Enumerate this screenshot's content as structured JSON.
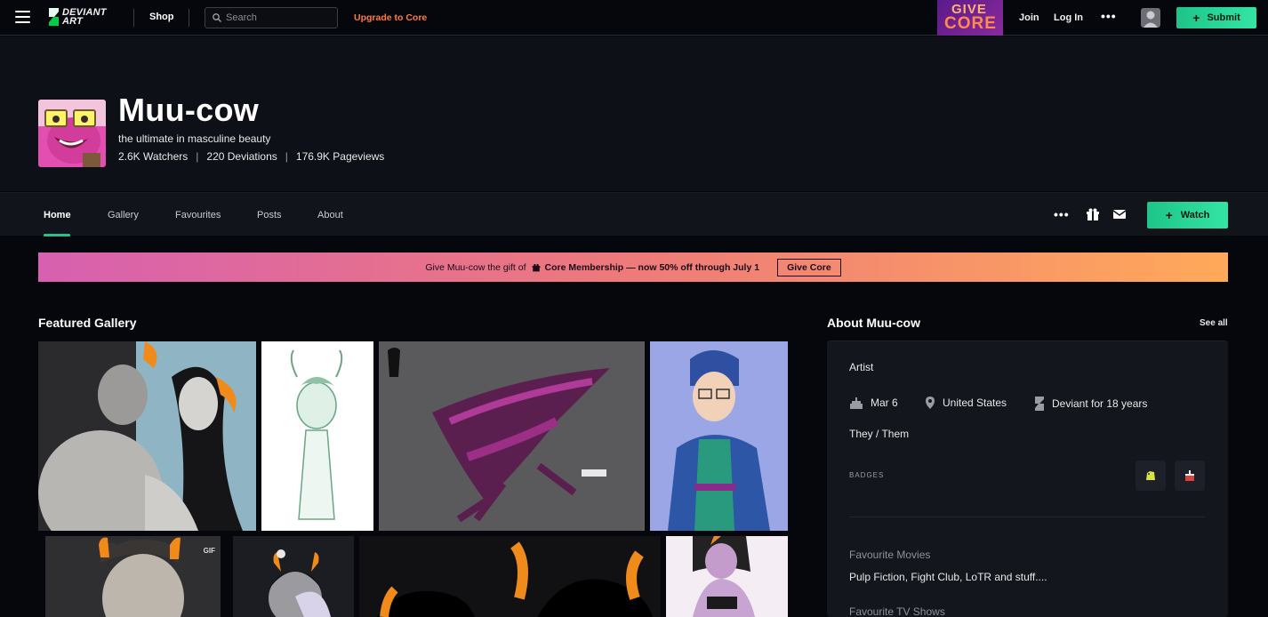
{
  "topbar": {
    "logo_line1": "DEVIANT",
    "logo_line2": "ART",
    "shop": "Shop",
    "search_placeholder": "Search",
    "upgrade": "Upgrade to Core",
    "give_core_line1": "GIVE",
    "give_core_line2": "CORE",
    "join": "Join",
    "login": "Log In",
    "more": "•••",
    "submit": "Submit"
  },
  "profile": {
    "name": "Muu-cow",
    "tagline": "the ultimate in masculine beauty",
    "watchers": "2.6K Watchers",
    "deviations": "220 Deviations",
    "pageviews": "176.9K Pageviews",
    "separator": "|"
  },
  "tabs": {
    "items": [
      {
        "label": "Home",
        "active": true
      },
      {
        "label": "Gallery",
        "active": false
      },
      {
        "label": "Favourites",
        "active": false
      },
      {
        "label": "Posts",
        "active": false
      },
      {
        "label": "About",
        "active": false
      }
    ],
    "more": "•••",
    "watch": "Watch"
  },
  "promo": {
    "text": "Give Muu-cow the gift of",
    "strong": "Core Membership — now 50% off through July 1",
    "button": "Give Core"
  },
  "featured": {
    "title": "Featured Gallery",
    "gif_badge": "GIF"
  },
  "about": {
    "title": "About Muu-cow",
    "see_all": "See all",
    "role": "Artist",
    "birthday": "Mar 6",
    "location": "United States",
    "member_since": "Deviant for 18 years",
    "pronouns": "They / Them",
    "badges_label": "BADGES",
    "fav_movies_label": "Favourite Movies",
    "fav_movies_value": "Pulp Fiction, Fight Club, LoTR and stuff....",
    "fav_tv_label": "Favourite TV Shows"
  },
  "colors": {
    "accent_green": "#1ec489",
    "upgrade_orange": "#ff7a3d",
    "background": "#06070d"
  }
}
